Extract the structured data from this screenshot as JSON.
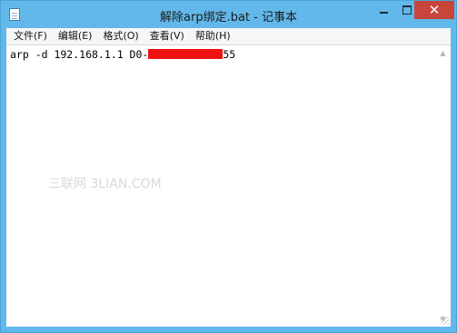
{
  "window": {
    "title": "解除arp绑定.bat - 记事本",
    "minimize_icon": "minimize-icon",
    "maximize_icon": "maximize-icon",
    "close_icon": "close-icon",
    "close_glyph": "✕",
    "app_icon": "notepad-icon",
    "titlebar_color": "#62b8ea",
    "close_color": "#c7453b"
  },
  "menu": {
    "items": [
      {
        "label": "文件(F)"
      },
      {
        "label": "编辑(E)"
      },
      {
        "label": "格式(O)"
      },
      {
        "label": "查看(V)"
      },
      {
        "label": "帮助(H)"
      }
    ]
  },
  "editor": {
    "line_prefix": "arp -d 192.168.1.1 D0-",
    "line_suffix": "55",
    "redaction_color": "#ee1111",
    "watermark": "三联网 3LIAN.COM"
  },
  "scrollbar": {
    "up_glyph": "▲",
    "down_glyph": "▼"
  }
}
